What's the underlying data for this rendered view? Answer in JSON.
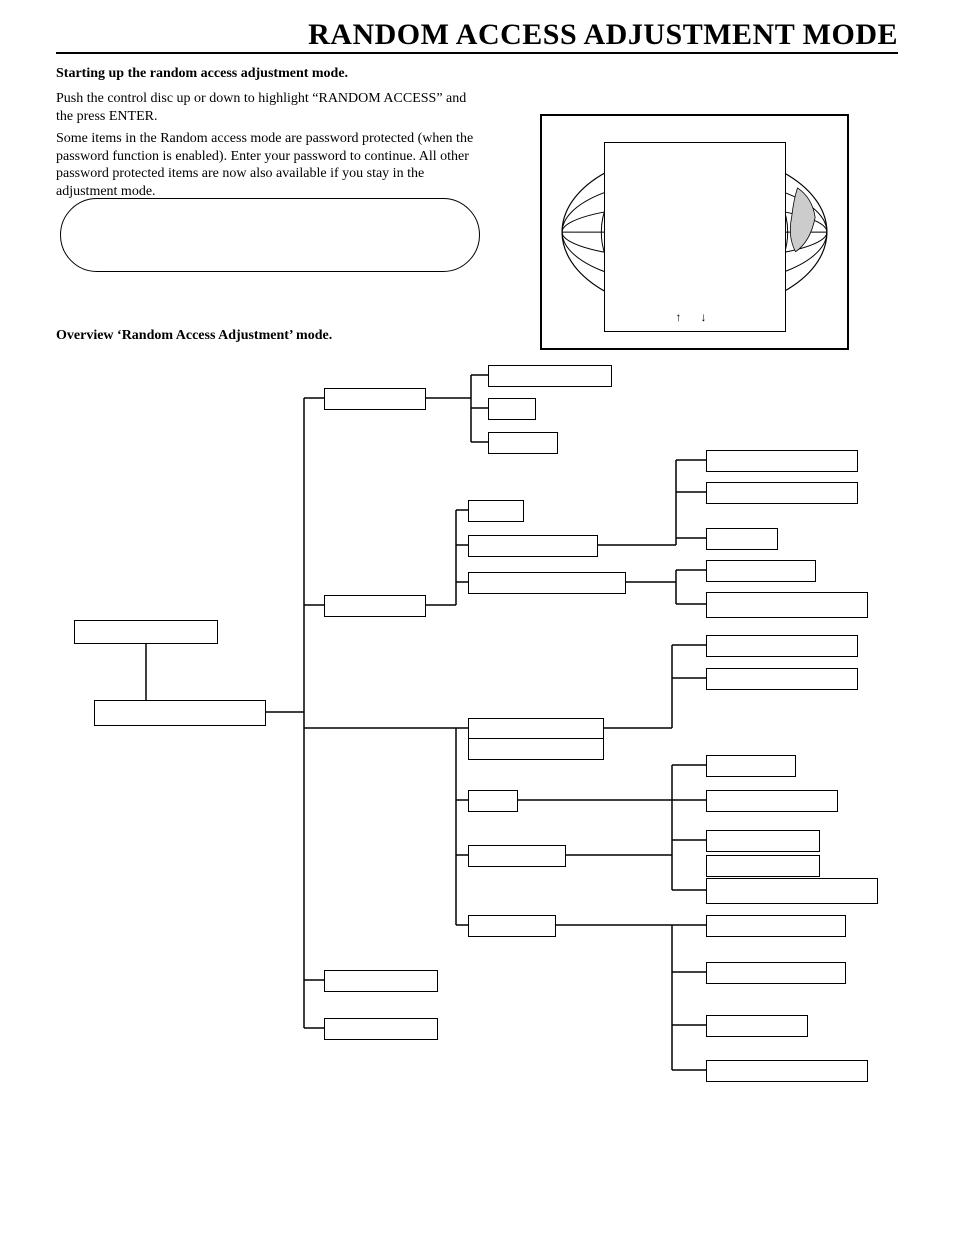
{
  "title": "RANDOM ACCESS ADJUSTMENT MODE",
  "heading_start": "Starting up the random access adjustment mode.",
  "para1": "Push the control disc up or down to highlight “RANDOM ACCESS” and the press ENTER.",
  "para2": "Some items in the Random access mode are password protected (when the password function is enabled). Enter your password to continue. All other password protected items are now also available if you stay in the adjustment mode.",
  "heading_overview": "Overview ‘Random Access Adjustment’ mode.",
  "arrows": "↑  ↓",
  "boxes": {
    "root1": "",
    "root2": "",
    "c1": "",
    "c1a": "",
    "c1b": "",
    "c1c": "",
    "c2": "",
    "c2a": "",
    "c2b": "",
    "c2c": "",
    "c2b1": "",
    "c2b2": "",
    "c2b3": "",
    "c2c1": "",
    "c2c2": "",
    "c3": "",
    "c3a": "",
    "c3b": "",
    "c3r1": "",
    "c3r2": "",
    "c3r3": "",
    "c3r4": "",
    "c3r5": "",
    "c3r6": "",
    "c3r7": "",
    "c3r8": "",
    "c4": "",
    "c4r1": "",
    "c4r2": "",
    "c4r3": "",
    "c4r4": "",
    "c5": "",
    "c6": ""
  }
}
